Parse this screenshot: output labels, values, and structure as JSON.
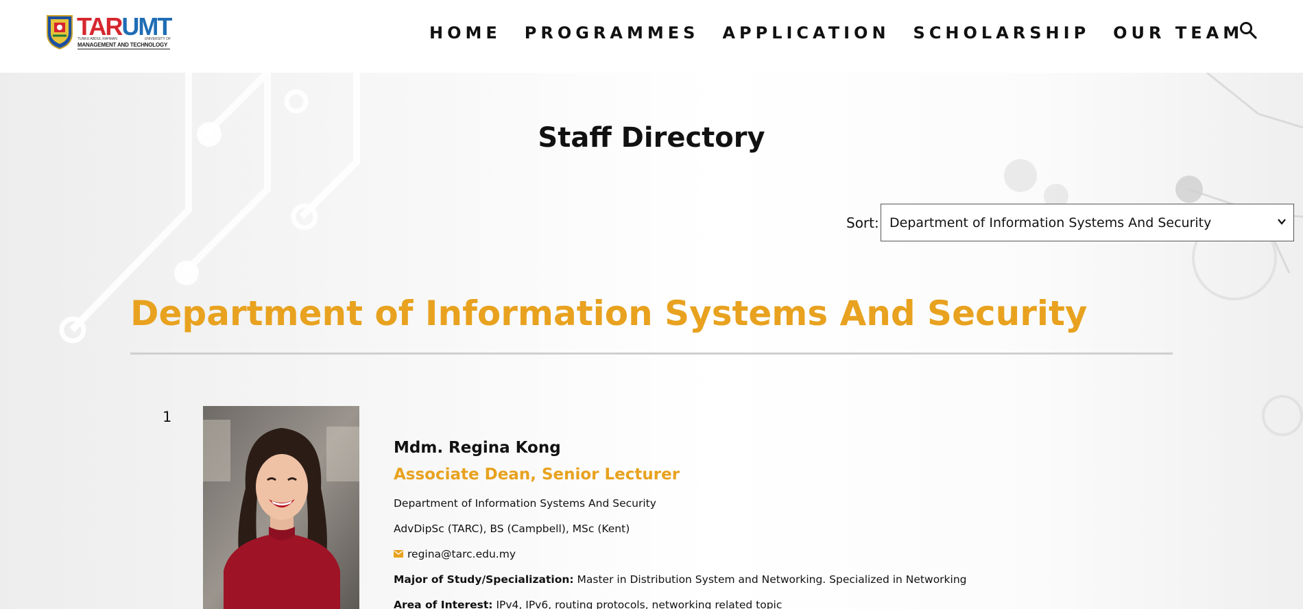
{
  "header": {
    "logo": {
      "brand_part1": "TAR",
      "brand_part2": "UMT",
      "sub_left": "TUNKU ABDUL RAHMAN",
      "sub_right": "UNIVERSITY OF",
      "sub_line": "MANAGEMENT AND TECHNOLOGY"
    },
    "nav": [
      "HOME",
      "PROGRAMMES",
      "APPLICATION",
      "SCHOLARSHIP",
      "OUR TEAM"
    ],
    "search_icon": "search-icon"
  },
  "page": {
    "title": "Staff Directory",
    "sort": {
      "label": "Sort:",
      "selected": "Department of Information Systems And Security"
    },
    "department_heading": "Department of Information Systems And Security"
  },
  "staff": [
    {
      "number": "1",
      "name": "Mdm. Regina Kong",
      "title": "Associate Dean, Senior Lecturer",
      "department": "Department of Information Systems And Security",
      "qualifications": "AdvDipSc (TARC), BS (Campbell), MSc (Kent)",
      "email": "regina@tarc.edu.my",
      "major_label": "Major of Study/Specialization:",
      "major_value": "Master in Distribution System and Networking. Specialized in Networking",
      "interest_label": "Area of Interest:",
      "interest_value": "IPv4, IPv6, routing protocols, networking related topic"
    }
  ],
  "colors": {
    "accent": "#e8a21f",
    "text": "#111111",
    "divider": "#cfcfcf"
  }
}
